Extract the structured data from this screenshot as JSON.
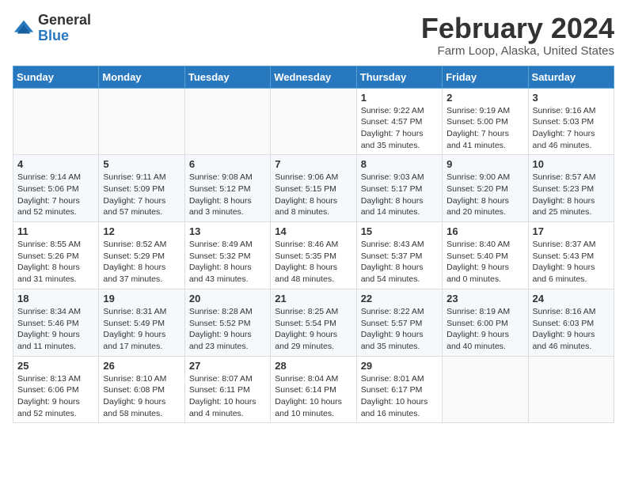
{
  "logo": {
    "general": "General",
    "blue": "Blue"
  },
  "title": "February 2024",
  "subtitle": "Farm Loop, Alaska, United States",
  "weekdays": [
    "Sunday",
    "Monday",
    "Tuesday",
    "Wednesday",
    "Thursday",
    "Friday",
    "Saturday"
  ],
  "weeks": [
    [
      {
        "day": "",
        "info": ""
      },
      {
        "day": "",
        "info": ""
      },
      {
        "day": "",
        "info": ""
      },
      {
        "day": "",
        "info": ""
      },
      {
        "day": "1",
        "info": "Sunrise: 9:22 AM\nSunset: 4:57 PM\nDaylight: 7 hours\nand 35 minutes."
      },
      {
        "day": "2",
        "info": "Sunrise: 9:19 AM\nSunset: 5:00 PM\nDaylight: 7 hours\nand 41 minutes."
      },
      {
        "day": "3",
        "info": "Sunrise: 9:16 AM\nSunset: 5:03 PM\nDaylight: 7 hours\nand 46 minutes."
      }
    ],
    [
      {
        "day": "4",
        "info": "Sunrise: 9:14 AM\nSunset: 5:06 PM\nDaylight: 7 hours\nand 52 minutes."
      },
      {
        "day": "5",
        "info": "Sunrise: 9:11 AM\nSunset: 5:09 PM\nDaylight: 7 hours\nand 57 minutes."
      },
      {
        "day": "6",
        "info": "Sunrise: 9:08 AM\nSunset: 5:12 PM\nDaylight: 8 hours\nand 3 minutes."
      },
      {
        "day": "7",
        "info": "Sunrise: 9:06 AM\nSunset: 5:15 PM\nDaylight: 8 hours\nand 8 minutes."
      },
      {
        "day": "8",
        "info": "Sunrise: 9:03 AM\nSunset: 5:17 PM\nDaylight: 8 hours\nand 14 minutes."
      },
      {
        "day": "9",
        "info": "Sunrise: 9:00 AM\nSunset: 5:20 PM\nDaylight: 8 hours\nand 20 minutes."
      },
      {
        "day": "10",
        "info": "Sunrise: 8:57 AM\nSunset: 5:23 PM\nDaylight: 8 hours\nand 25 minutes."
      }
    ],
    [
      {
        "day": "11",
        "info": "Sunrise: 8:55 AM\nSunset: 5:26 PM\nDaylight: 8 hours\nand 31 minutes."
      },
      {
        "day": "12",
        "info": "Sunrise: 8:52 AM\nSunset: 5:29 PM\nDaylight: 8 hours\nand 37 minutes."
      },
      {
        "day": "13",
        "info": "Sunrise: 8:49 AM\nSunset: 5:32 PM\nDaylight: 8 hours\nand 43 minutes."
      },
      {
        "day": "14",
        "info": "Sunrise: 8:46 AM\nSunset: 5:35 PM\nDaylight: 8 hours\nand 48 minutes."
      },
      {
        "day": "15",
        "info": "Sunrise: 8:43 AM\nSunset: 5:37 PM\nDaylight: 8 hours\nand 54 minutes."
      },
      {
        "day": "16",
        "info": "Sunrise: 8:40 AM\nSunset: 5:40 PM\nDaylight: 9 hours\nand 0 minutes."
      },
      {
        "day": "17",
        "info": "Sunrise: 8:37 AM\nSunset: 5:43 PM\nDaylight: 9 hours\nand 6 minutes."
      }
    ],
    [
      {
        "day": "18",
        "info": "Sunrise: 8:34 AM\nSunset: 5:46 PM\nDaylight: 9 hours\nand 11 minutes."
      },
      {
        "day": "19",
        "info": "Sunrise: 8:31 AM\nSunset: 5:49 PM\nDaylight: 9 hours\nand 17 minutes."
      },
      {
        "day": "20",
        "info": "Sunrise: 8:28 AM\nSunset: 5:52 PM\nDaylight: 9 hours\nand 23 minutes."
      },
      {
        "day": "21",
        "info": "Sunrise: 8:25 AM\nSunset: 5:54 PM\nDaylight: 9 hours\nand 29 minutes."
      },
      {
        "day": "22",
        "info": "Sunrise: 8:22 AM\nSunset: 5:57 PM\nDaylight: 9 hours\nand 35 minutes."
      },
      {
        "day": "23",
        "info": "Sunrise: 8:19 AM\nSunset: 6:00 PM\nDaylight: 9 hours\nand 40 minutes."
      },
      {
        "day": "24",
        "info": "Sunrise: 8:16 AM\nSunset: 6:03 PM\nDaylight: 9 hours\nand 46 minutes."
      }
    ],
    [
      {
        "day": "25",
        "info": "Sunrise: 8:13 AM\nSunset: 6:06 PM\nDaylight: 9 hours\nand 52 minutes."
      },
      {
        "day": "26",
        "info": "Sunrise: 8:10 AM\nSunset: 6:08 PM\nDaylight: 9 hours\nand 58 minutes."
      },
      {
        "day": "27",
        "info": "Sunrise: 8:07 AM\nSunset: 6:11 PM\nDaylight: 10 hours\nand 4 minutes."
      },
      {
        "day": "28",
        "info": "Sunrise: 8:04 AM\nSunset: 6:14 PM\nDaylight: 10 hours\nand 10 minutes."
      },
      {
        "day": "29",
        "info": "Sunrise: 8:01 AM\nSunset: 6:17 PM\nDaylight: 10 hours\nand 16 minutes."
      },
      {
        "day": "",
        "info": ""
      },
      {
        "day": "",
        "info": ""
      }
    ]
  ]
}
